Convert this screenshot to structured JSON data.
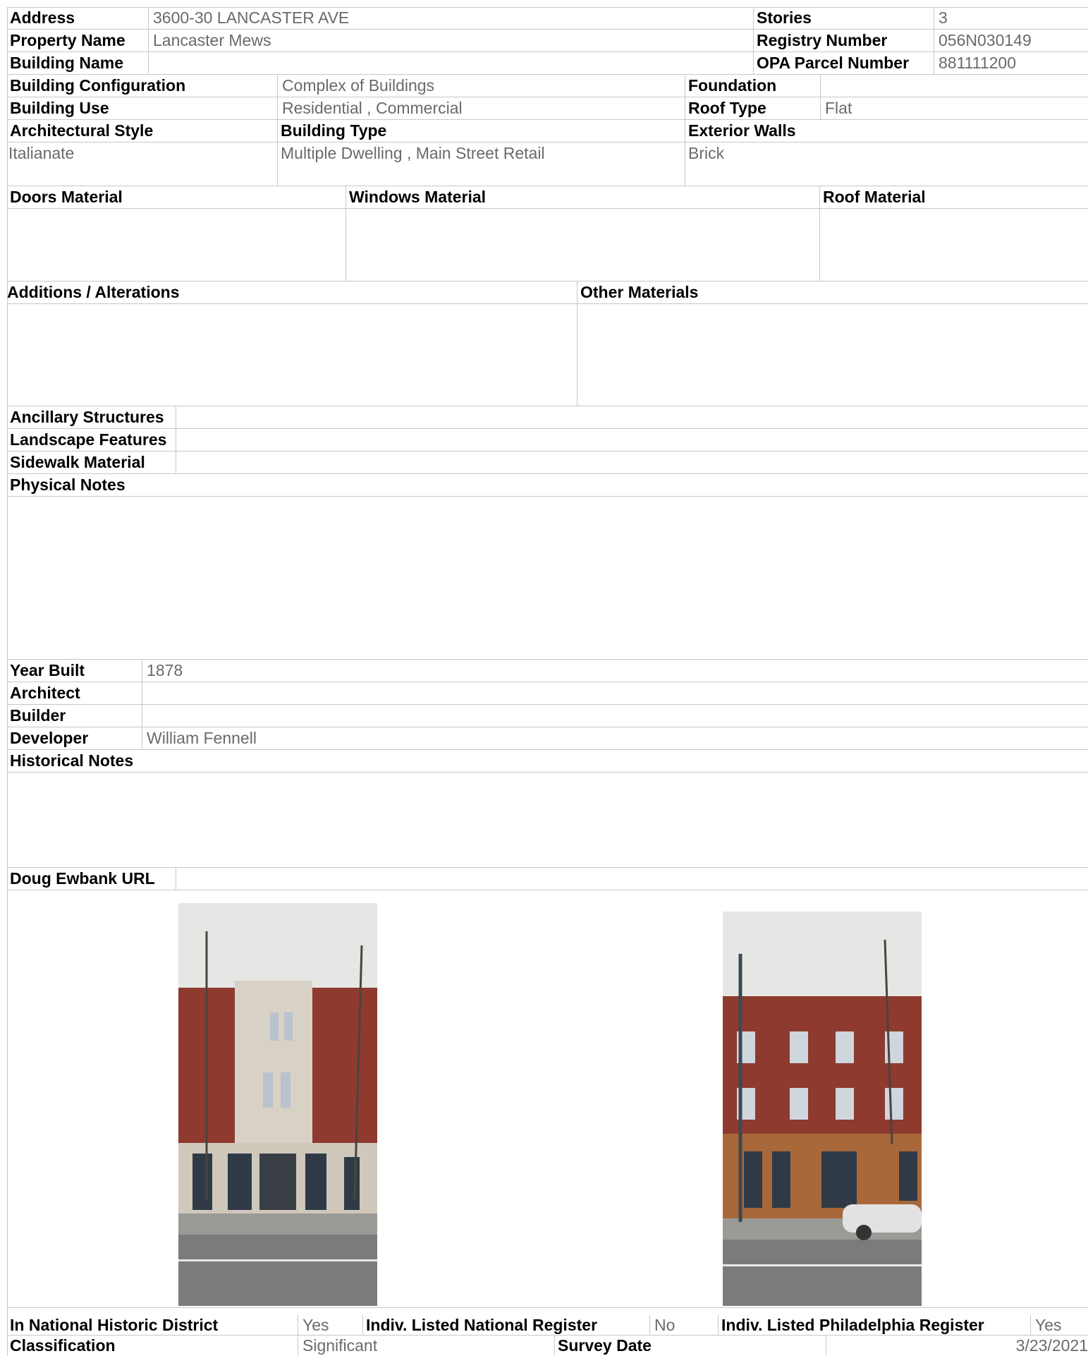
{
  "address": {
    "label": "Address",
    "value": "3600-30 LANCASTER AVE"
  },
  "stories": {
    "label": "Stories",
    "value": "3"
  },
  "property_name": {
    "label": "Property Name",
    "value": "Lancaster Mews"
  },
  "registry_number": {
    "label": "Registry Number",
    "value": "056N030149"
  },
  "building_name": {
    "label": "Building Name",
    "value": ""
  },
  "opa_parcel": {
    "label": "OPA Parcel Number",
    "value": "881111200"
  },
  "building_configuration": {
    "label": "Building Configuration",
    "value": "Complex of Buildings"
  },
  "foundation": {
    "label": "Foundation",
    "value": ""
  },
  "building_use": {
    "label": "Building Use",
    "value": "Residential , Commercial"
  },
  "roof_type": {
    "label": "Roof Type",
    "value": "Flat"
  },
  "architectural_style": {
    "label": "Architectural Style",
    "value": "Italianate"
  },
  "building_type": {
    "label": "Building Type",
    "value": "Multiple Dwelling , Main Street Retail"
  },
  "exterior_walls": {
    "label": "Exterior Walls",
    "value": "Brick"
  },
  "doors_material": {
    "label": "Doors Material",
    "value": ""
  },
  "windows_material": {
    "label": "Windows Material",
    "value": ""
  },
  "roof_material": {
    "label": "Roof Material",
    "value": ""
  },
  "additions_alterations": {
    "label": "Additions / Alterations",
    "value": ""
  },
  "other_materials": {
    "label": "Other Materials",
    "value": ""
  },
  "ancillary_structures": {
    "label": "Ancillary Structures",
    "value": ""
  },
  "landscape_features": {
    "label": "Landscape Features",
    "value": ""
  },
  "sidewalk_material": {
    "label": "Sidewalk Material",
    "value": ""
  },
  "physical_notes": {
    "label": "Physical Notes",
    "value": ""
  },
  "year_built": {
    "label": "Year Built",
    "value": "1878"
  },
  "architect": {
    "label": "Architect",
    "value": ""
  },
  "builder": {
    "label": "Builder",
    "value": ""
  },
  "developer": {
    "label": "Developer",
    "value": "William Fennell"
  },
  "historical_notes": {
    "label": "Historical Notes",
    "value": ""
  },
  "doug_ewbank_url": {
    "label": "Doug Ewbank URL",
    "value": ""
  },
  "national_district": {
    "label": "In National Historic District",
    "value": "Yes"
  },
  "national_register": {
    "label": "Indiv. Listed National Register",
    "value": "No"
  },
  "philadelphia_register": {
    "label": "Indiv. Listed Philadelphia Register",
    "value": "Yes"
  },
  "classification": {
    "label": "Classification",
    "value": "Significant"
  },
  "survey_date": {
    "label": "Survey Date",
    "value": "3/23/2021"
  },
  "photo_colors": {
    "brick": "#8e3a2e",
    "stone": "#d8d2c6",
    "sky": "#e6e6e4",
    "street": "#7b7b7b",
    "storefront": "#2f3a46"
  }
}
